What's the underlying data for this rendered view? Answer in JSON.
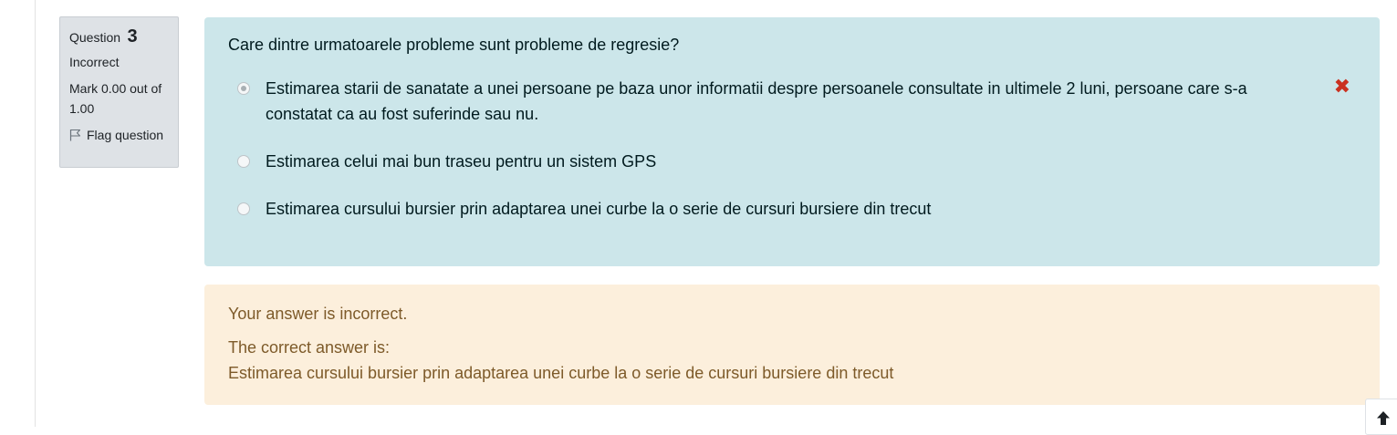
{
  "info": {
    "question_label": "Question",
    "question_number": "3",
    "state": "Incorrect",
    "mark": "Mark 0.00 out of 1.00",
    "flag_label": "Flag question"
  },
  "question": {
    "text": "Care dintre urmatoarele probleme sunt probleme de regresie?",
    "answers": [
      {
        "text": "Estimarea starii de sanatate a unei persoane pe baza unor informatii despre persoanele consultate in ultimele 2 luni, persoane care s-a constatat ca au fost suferinde sau nu.",
        "selected": true,
        "mark_icon": "cross-icon"
      },
      {
        "text": "Estimarea celui mai bun traseu pentru un sistem GPS",
        "selected": false
      },
      {
        "text": "Estimarea cursului bursier prin adaptarea unei curbe la o serie de cursuri bursiere din trecut",
        "selected": false
      }
    ]
  },
  "feedback": {
    "status": "Your answer is incorrect.",
    "correct_label": "The correct answer is:",
    "correct_answer": "Estimarea cursului bursier prin adaptarea unei curbe la o serie de cursuri bursiere din trecut"
  },
  "colors": {
    "question_bg": "#cce6ea",
    "feedback_bg": "#fcefdc",
    "info_bg": "#dee2e6",
    "incorrect_icon": "#ca3120"
  },
  "icons": {
    "wrong": "✖",
    "flag": "flag-icon",
    "scroll_top": "arrow-up-icon"
  }
}
